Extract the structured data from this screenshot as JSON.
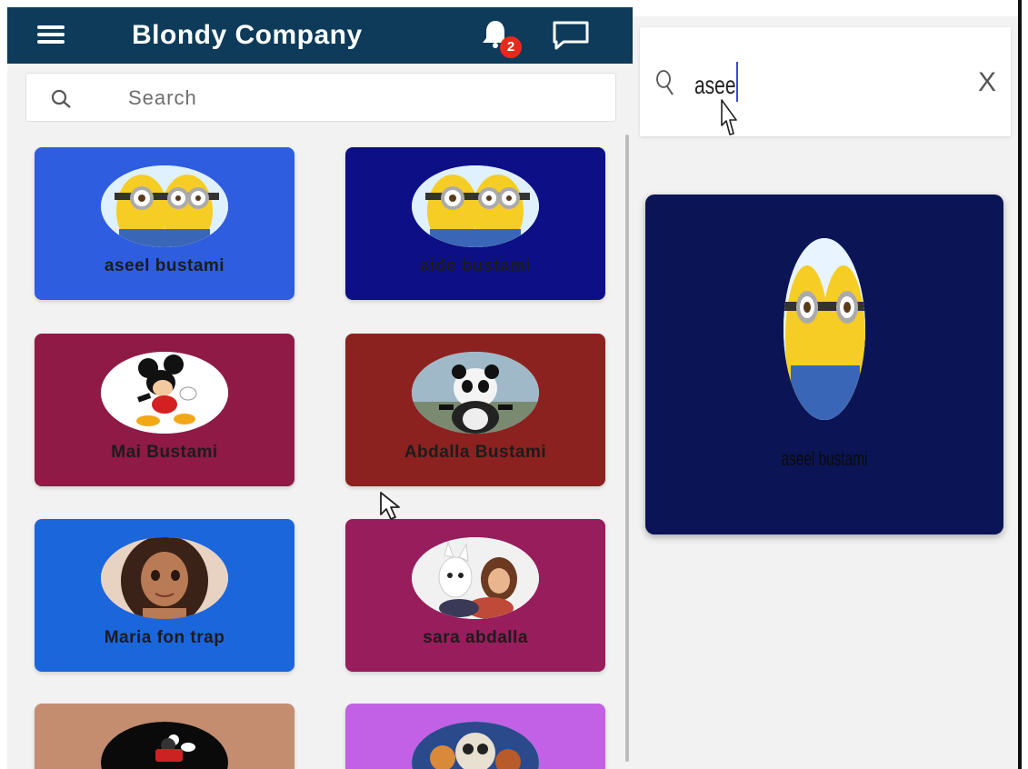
{
  "left_app": {
    "title": "Blondy Company",
    "notification_count": "2",
    "search_placeholder": "Search",
    "cards": [
      {
        "name": "aseel bustami",
        "color": "#2e5de0",
        "avatar": "minions"
      },
      {
        "name": "aide bustami",
        "color": "#0c0f86",
        "avatar": "minions"
      },
      {
        "name": "Mai Bustami",
        "color": "#8e1a45",
        "avatar": "mickey"
      },
      {
        "name": "Abdalla Bustami",
        "color": "#8c2220",
        "avatar": "kung-fu-panda"
      },
      {
        "name": "Maria fon  trap",
        "color": "#1c66dc",
        "avatar": "moana"
      },
      {
        "name": "sara abdalla",
        "color": "#981d5c",
        "avatar": "bolt-and-girl"
      },
      {
        "name": "",
        "color": "#c48d70",
        "avatar": "mickey-dark"
      },
      {
        "name": "",
        "color": "#c261e6",
        "avatar": "coco"
      }
    ]
  },
  "right_app": {
    "search_query": "asee",
    "clear_label": "X",
    "result": {
      "name": "aseel bustami",
      "color": "#0b1555",
      "avatar": "minions"
    }
  }
}
